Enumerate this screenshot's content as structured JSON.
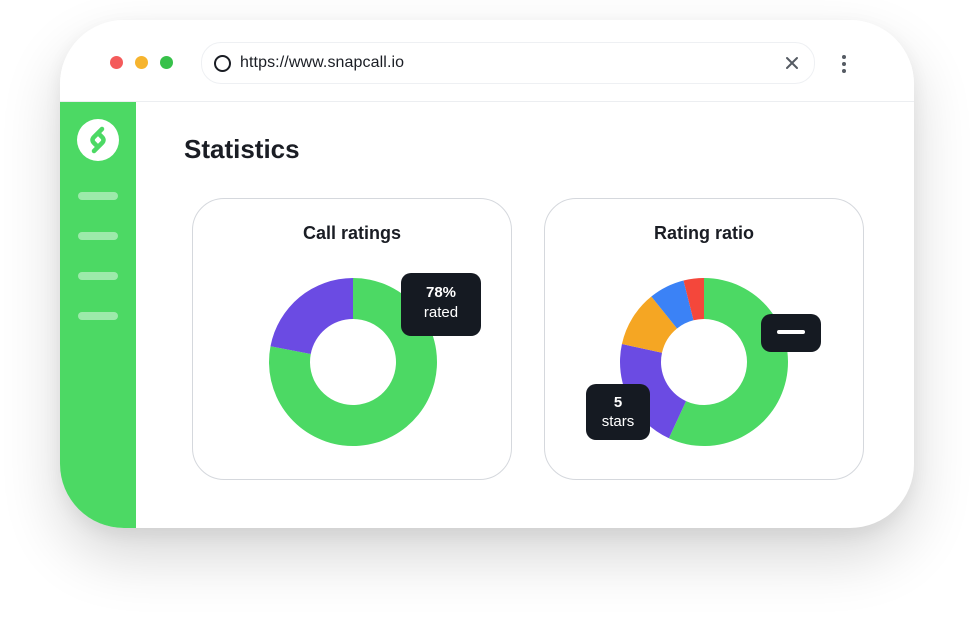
{
  "browser": {
    "url": "https://www.snapcall.io",
    "controls": [
      "close-dot",
      "minimize-dot",
      "maximize-dot"
    ]
  },
  "sidebar": {
    "logo": "snapcall-logo",
    "items": [
      "nav-item-1",
      "nav-item-2",
      "nav-item-3",
      "nav-item-4"
    ]
  },
  "page": {
    "title": "Statistics"
  },
  "colors": {
    "brand_green": "#4cd964",
    "purple": "#6b4be3",
    "orange": "#f5a623",
    "blue": "#3b82f6",
    "red": "#f4473b",
    "tooltip_bg": "#151a22"
  },
  "cards": {
    "call_ratings": {
      "title": "Call ratings",
      "tooltip_value": "78%",
      "tooltip_label": "rated"
    },
    "rating_ratio": {
      "title": "Rating ratio",
      "tooltip_value": "5",
      "tooltip_label": "stars"
    }
  },
  "chart_data": [
    {
      "type": "pie",
      "title": "Call ratings",
      "series": [
        {
          "label": "rated",
          "value": 78,
          "color": "#4cd964"
        },
        {
          "value": 22,
          "color": "#6b4be3"
        }
      ]
    },
    {
      "type": "pie",
      "title": "Rating ratio",
      "series": [
        {
          "label": "5 stars",
          "value": 58,
          "color": "#4cd964"
        },
        {
          "value": 22,
          "color": "#6b4be3"
        },
        {
          "value": 11,
          "color": "#f5a623"
        },
        {
          "value": 7,
          "color": "#3b82f6"
        },
        {
          "value": 4,
          "color": "#f4473b"
        }
      ]
    }
  ]
}
